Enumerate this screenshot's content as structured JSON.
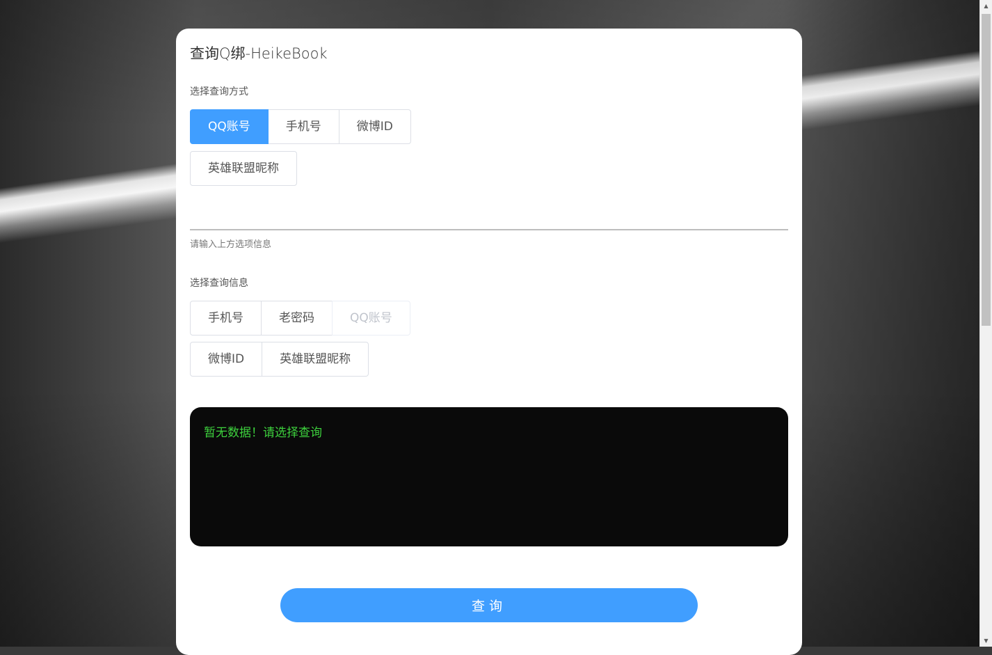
{
  "page": {
    "title": "查询Q绑-HeikeBook",
    "accent_color": "#409eff",
    "terminal_text_color": "#3dd13d"
  },
  "method_section": {
    "label": "选择查询方式",
    "options": [
      "QQ账号",
      "手机号",
      "微博ID",
      "英雄联盟昵称"
    ],
    "selected": "QQ账号"
  },
  "input": {
    "value": "",
    "helper": "请输入上方选项信息"
  },
  "info_section": {
    "label": "选择查询信息",
    "options": [
      "手机号",
      "老密码",
      "QQ账号",
      "微博ID",
      "英雄联盟昵称"
    ],
    "disabled": [
      "QQ账号"
    ]
  },
  "result": {
    "text": "暂无数据！请选择查询"
  },
  "submit": {
    "label": "查询"
  },
  "scrollbar": {
    "up_icon": "triangle-up-icon",
    "down_icon": "triangle-down-icon"
  }
}
